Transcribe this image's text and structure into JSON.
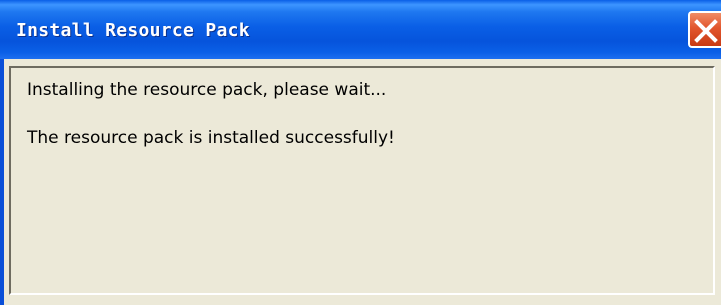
{
  "window": {
    "title": "Install Resource Pack",
    "close_icon": "close-icon"
  },
  "log": {
    "lines": [
      "Installing the resource pack, please wait...",
      "The resource pack is installed successfully!"
    ]
  },
  "colors": {
    "titlebar": "#0a5fe6",
    "close_button": "#e2562d",
    "background": "#ece9d8",
    "text": "#000000"
  }
}
